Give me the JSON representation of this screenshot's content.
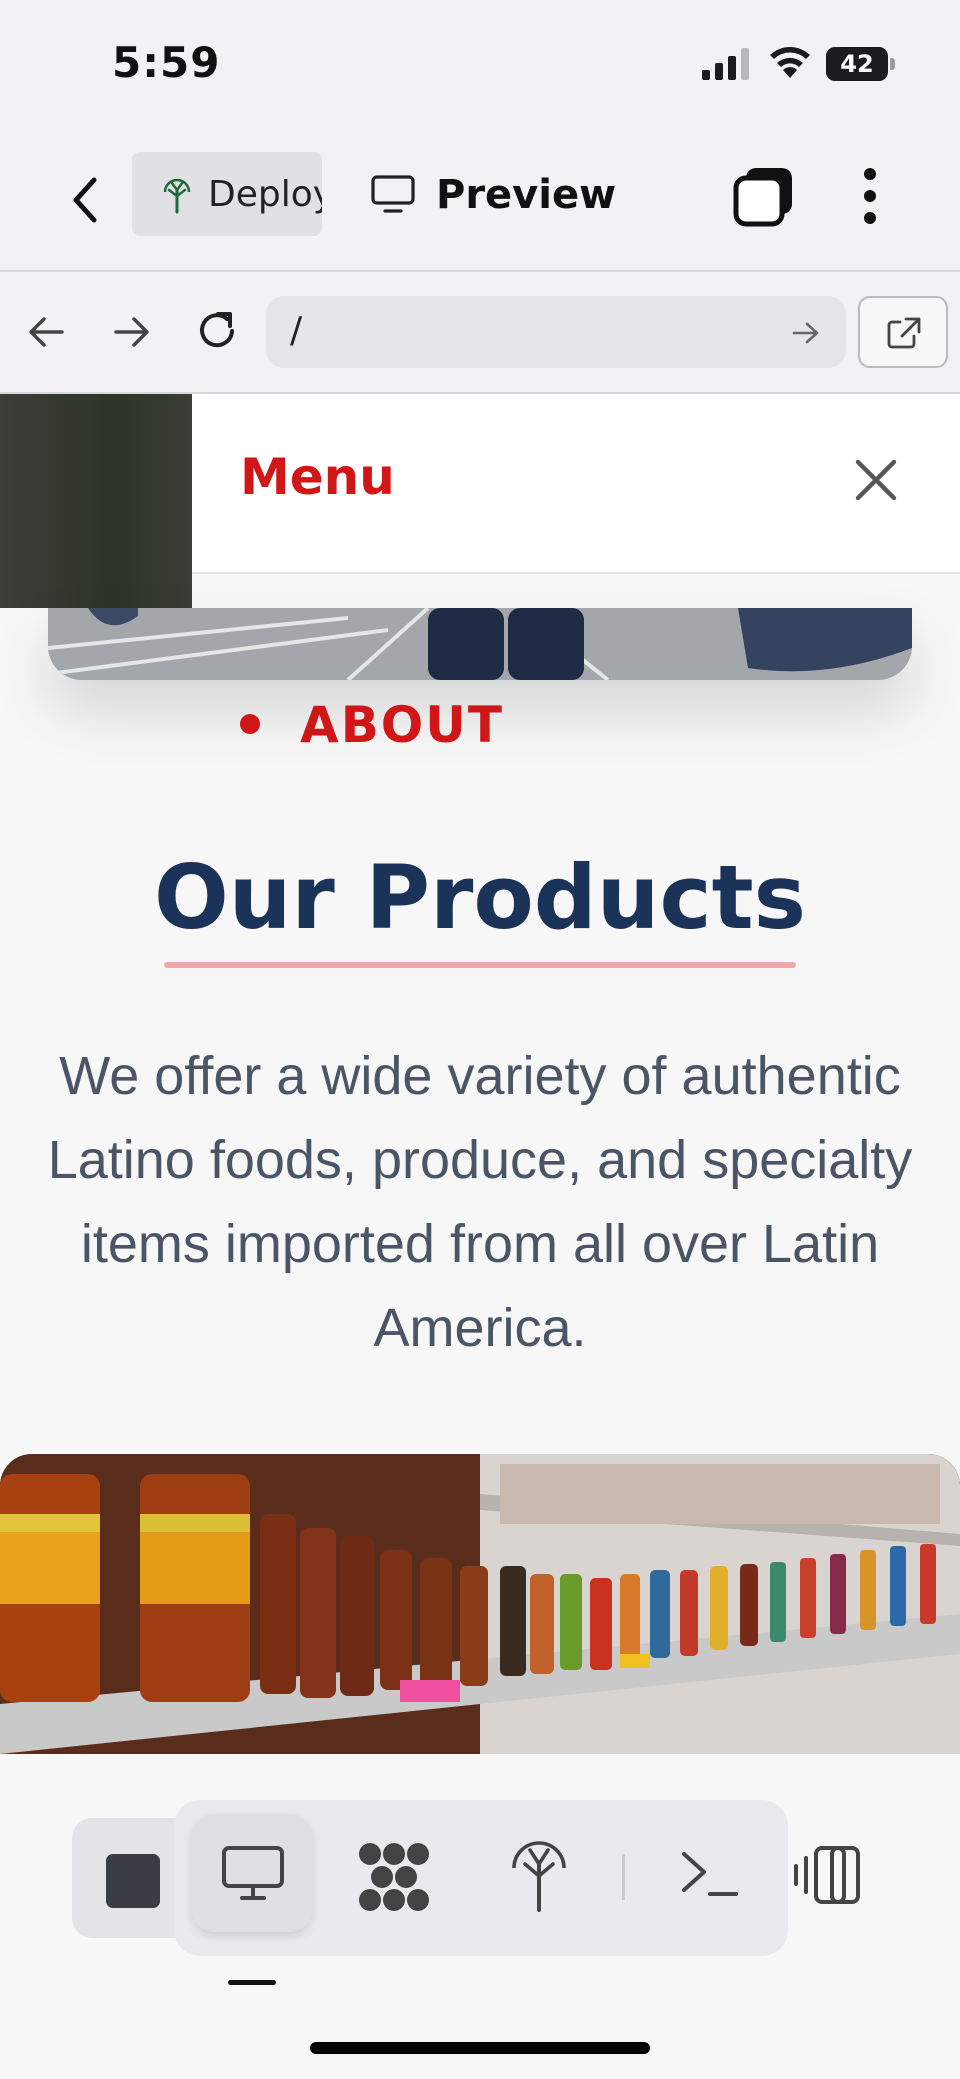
{
  "status_bar": {
    "time": "5:59",
    "battery": "42"
  },
  "toolbar": {
    "deploy_label": "Deploy",
    "preview_label": "Preview"
  },
  "browser": {
    "url": "/"
  },
  "menu": {
    "title": "Menu"
  },
  "nav": {
    "about_label": "ABOUT"
  },
  "products": {
    "title": "Our Products",
    "description": "We offer a wide variety of authentic Latino foods, produce, and specialty items imported from all over Latin America."
  },
  "colors": {
    "brand_red": "#d01617",
    "heading_navy": "#1b3358",
    "underline_pink": "#f1a7a9"
  },
  "icons": [
    "back-chevron-icon",
    "deploy-icon",
    "monitor-icon",
    "tabs-icon",
    "more-vertical-icon",
    "arrow-left-icon",
    "arrow-right-icon",
    "reload-icon",
    "external-link-icon",
    "close-icon",
    "stop-icon",
    "desktop-icon",
    "pattern-icon",
    "deploy-tree-icon",
    "terminal-icon",
    "device-toggle-icon"
  ]
}
